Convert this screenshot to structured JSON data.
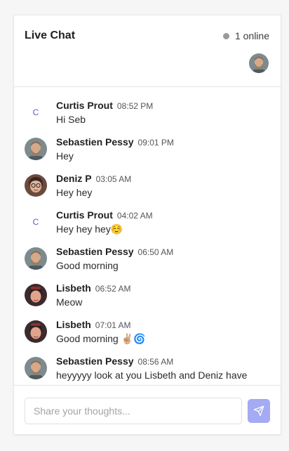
{
  "header": {
    "title": "Live Chat",
    "online_label": "1 online",
    "avatar_icon": "user-avatar-icon"
  },
  "messages": [
    {
      "name": "Curtis Prout",
      "time": "08:52 PM",
      "text": "Hi Seb",
      "avatar_letter": "C"
    },
    {
      "name": "Sebastien Pessy",
      "time": "09:01 PM",
      "text": "Hey"
    },
    {
      "name": "Deniz P",
      "time": "03:05 AM",
      "text": "Hey hey"
    },
    {
      "name": "Curtis Prout",
      "time": "04:02 AM",
      "text": "Hey hey hey☺️",
      "avatar_letter": "C"
    },
    {
      "name": "Sebastien Pessy",
      "time": "06:50 AM",
      "text": "Good morning"
    },
    {
      "name": "Lisbeth",
      "time": "06:52 AM",
      "text": "Meow"
    },
    {
      "name": "Lisbeth",
      "time": "07:01 AM",
      "text": "Good morning ✌🏼🌀"
    },
    {
      "name": "Sebastien Pessy",
      "time": "08:56 AM",
      "text": "heyyyyy look at you Lisbeth and Deniz have"
    }
  ],
  "composer": {
    "placeholder": "Share your thoughts...",
    "send_icon": "send-icon"
  },
  "colors": {
    "accent": "#a4aaf3",
    "letter_avatar": "#4f5fc7",
    "online_dot": "#9a9a9e"
  }
}
